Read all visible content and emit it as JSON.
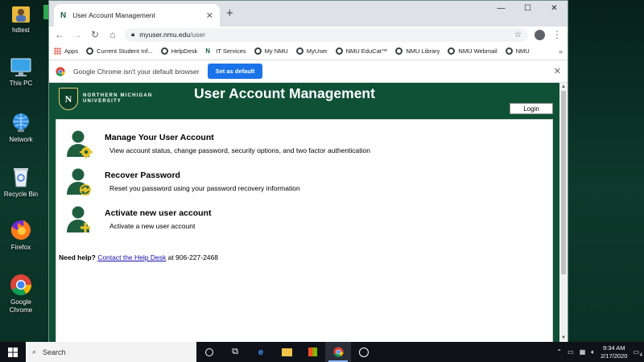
{
  "desktop": {
    "icons": [
      {
        "label": "hdtest"
      },
      {
        "label": "This PC"
      },
      {
        "label": "Network"
      },
      {
        "label": "Recycle Bin"
      },
      {
        "label": "Firefox"
      },
      {
        "label": "Google Chrome"
      }
    ]
  },
  "browser": {
    "tab_title": "User Account Management",
    "url_host": "myuser.nmu.edu",
    "url_path": "/user",
    "bookmarks": [
      "Apps",
      "Current Student Inf...",
      "HelpDesk",
      "IT Services",
      "My NMU",
      "MyUser",
      "NMU EduCat™",
      "NMU Library",
      "NMU Webmail",
      "NMU"
    ],
    "bookmarks_more": "»",
    "infobar_message": "Google Chrome isn't your default browser",
    "infobar_button": "Set as default"
  },
  "page": {
    "logo_line1": "NORTHERN MICHIGAN",
    "logo_line2": "UNIVERSITY",
    "title": "User Account Management",
    "login_label": "Login",
    "options": [
      {
        "title": "Manage Your User Account",
        "desc": "View account status, change password, security options, and two factor authentication",
        "icon": "user-gear-icon"
      },
      {
        "title": "Recover Password",
        "desc": "Reset you password using your password recovery information",
        "icon": "user-refresh-icon"
      },
      {
        "title": "Activate new user account",
        "desc": "Activate a new user account",
        "icon": "user-plus-icon"
      }
    ],
    "help_prefix": "Need help?",
    "help_link": "Contact the Help Desk",
    "help_suffix": "at 906-227-2468"
  },
  "taskbar": {
    "search_placeholder": "Search",
    "time": "9:34 AM",
    "date": "2/17/2020",
    "notification_count": "4"
  },
  "colors": {
    "nmu_green": "#0f5137",
    "icon_green": "#1e5e3e",
    "icon_gold": "#e6c229",
    "link": "#1a0dab"
  }
}
